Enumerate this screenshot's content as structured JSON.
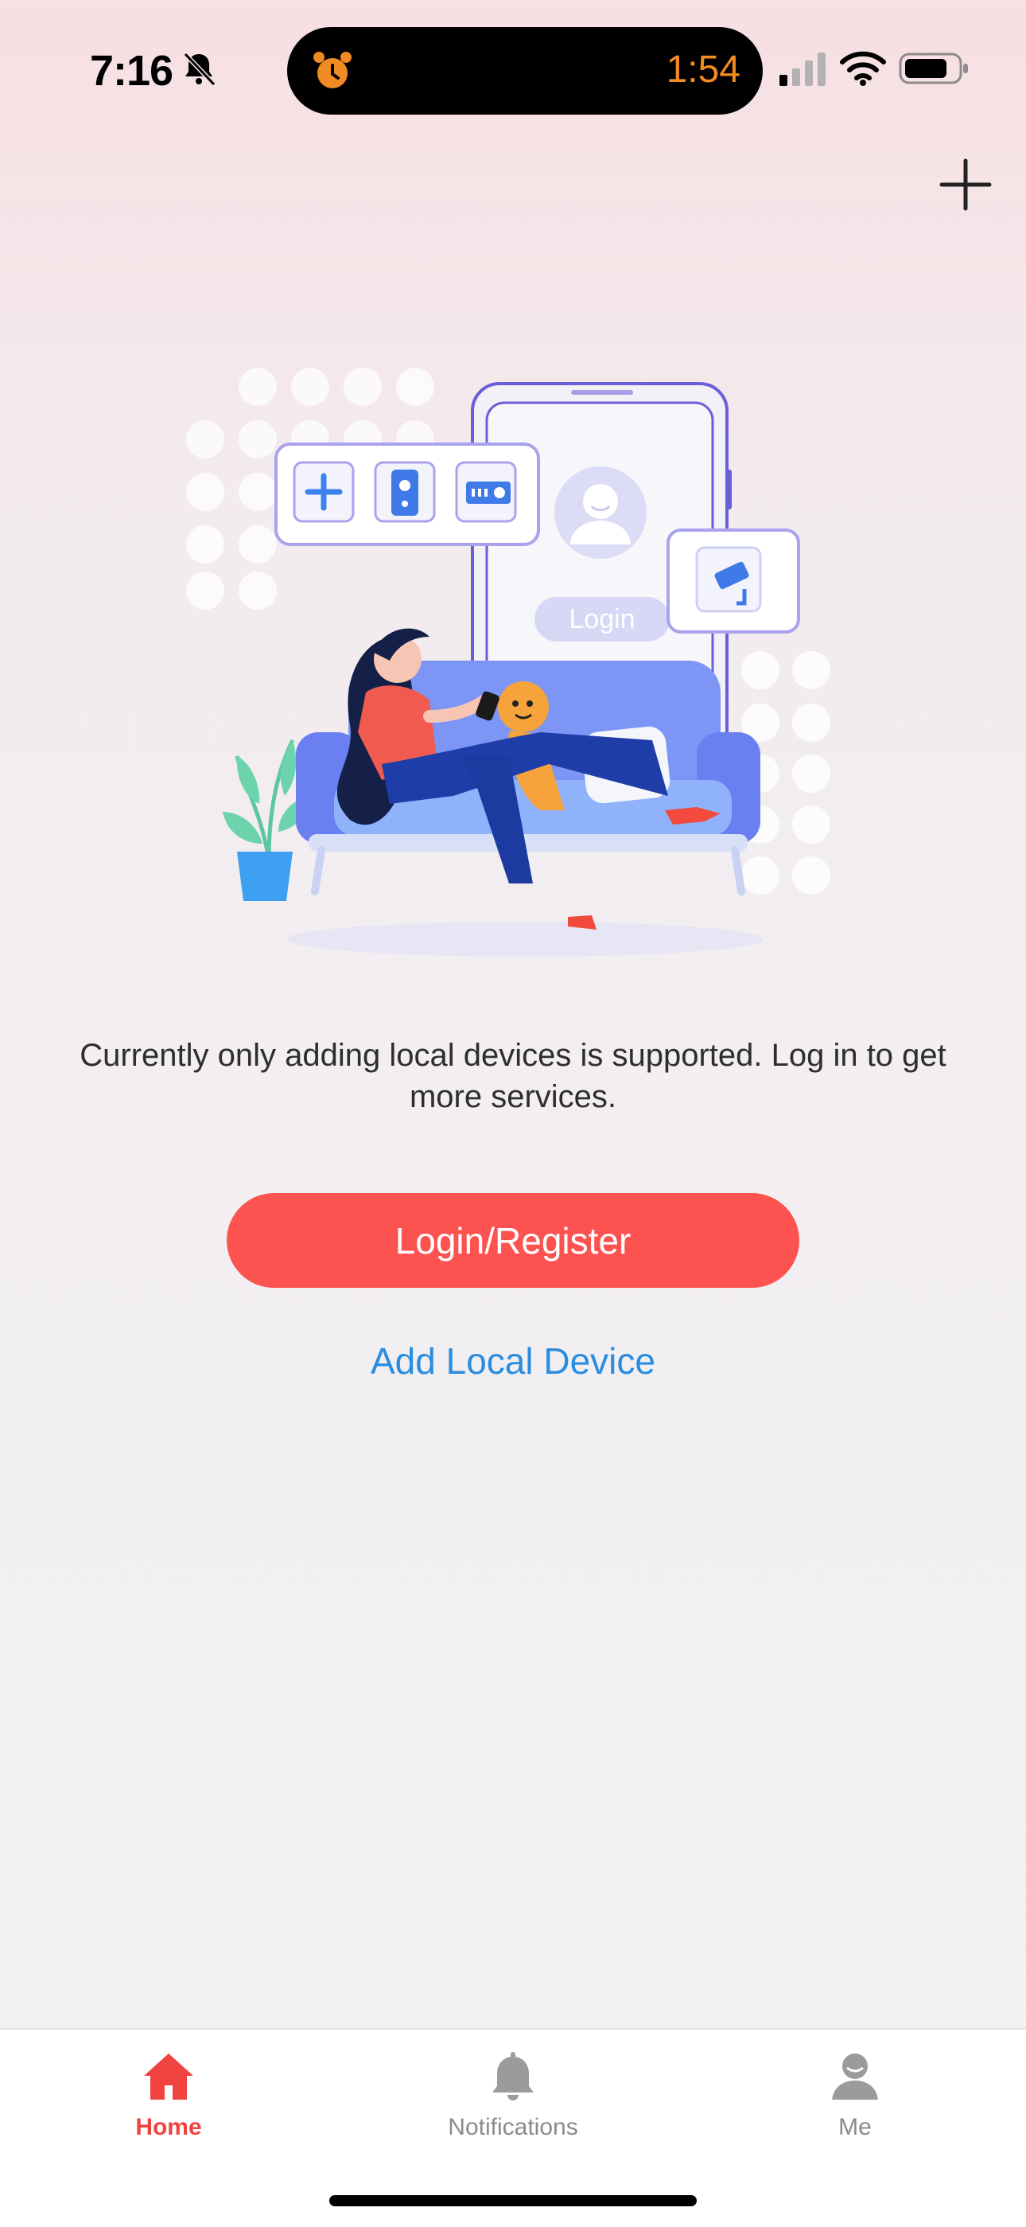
{
  "status_bar": {
    "time": "7:16",
    "timer": "1:54"
  },
  "illustration": {
    "login_label": "Login"
  },
  "main": {
    "message": "Currently only adding local devices is supported. Log in to get more services.",
    "login_button": "Login/Register",
    "add_local_device": "Add Local Device"
  },
  "tabs": [
    {
      "label": "Home",
      "icon": "home-icon",
      "active": true
    },
    {
      "label": "Notifications",
      "icon": "bell-icon",
      "active": false
    },
    {
      "label": "Me",
      "icon": "person-icon",
      "active": false
    }
  ],
  "colors": {
    "accent": "#fd5350",
    "link": "#2a8de0",
    "timer": "#f08a22"
  }
}
